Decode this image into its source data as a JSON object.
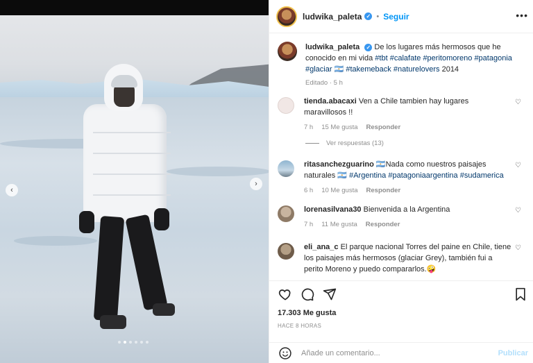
{
  "post": {
    "username": "ludwika_paleta",
    "follow_label": "Seguir",
    "separator": "•",
    "caption_parts": {
      "text": "De los lugares más hermosos que he conocido en mi vida",
      "tags": [
        "#tbt",
        "#calafate",
        "#peritomoreno",
        "#patagonia",
        "#glaciar",
        "🇦🇷",
        "#takemeback",
        "#naturelovers",
        "2014"
      ]
    },
    "caption_meta": "Editado · 5 h"
  },
  "comments": [
    {
      "username": "tienda.abacaxi",
      "text": "Ven a Chile tambien hay lugares maravillosos !!",
      "time": "7 h",
      "likes": "15 Me gusta",
      "reply_label": "Responder",
      "avatar_color": "#f1e7e5"
    },
    {
      "username": "ritasanchezguarino",
      "text_prefix": "🇦🇷Nada como nuestros paisajes naturales 🇦🇷",
      "tags": [
        "#Argentina",
        "#patagoniaargentina",
        "#sudamerica"
      ],
      "time": "6 h",
      "likes": "10 Me gusta",
      "reply_label": "Responder",
      "avatar_color": "#8fb5d0"
    },
    {
      "username": "lorenasilvana30",
      "text": "Bienvenida a la Argentina",
      "time": "7 h",
      "likes": "11 Me gusta",
      "reply_label": "Responder",
      "avatar_color": "#b9a590"
    },
    {
      "username": "eli_ana_c",
      "text": "El parque nacional Torres del paine en Chile, tiene los paisajes más hermosos (glaciar Grey), también fui a perito Moreno y puedo compararlos.🤪",
      "avatar_color": "#a8937e"
    }
  ],
  "view_replies": "Ver respuestas (13)",
  "likes_count": "17.303 Me gusta",
  "posted_ago": "HACE 8 HORAS",
  "add_comment_placeholder": "Añade un comentario...",
  "publish_label": "Publicar",
  "colors": {
    "accent": "#0095f6",
    "verified": "#3897f0",
    "publish_disabled": "#b2dffc"
  },
  "icons": [
    "heart-icon",
    "comment-icon",
    "share-icon",
    "bookmark-icon",
    "emoji-icon",
    "more-icon",
    "chevron-left-icon",
    "chevron-right-icon"
  ]
}
